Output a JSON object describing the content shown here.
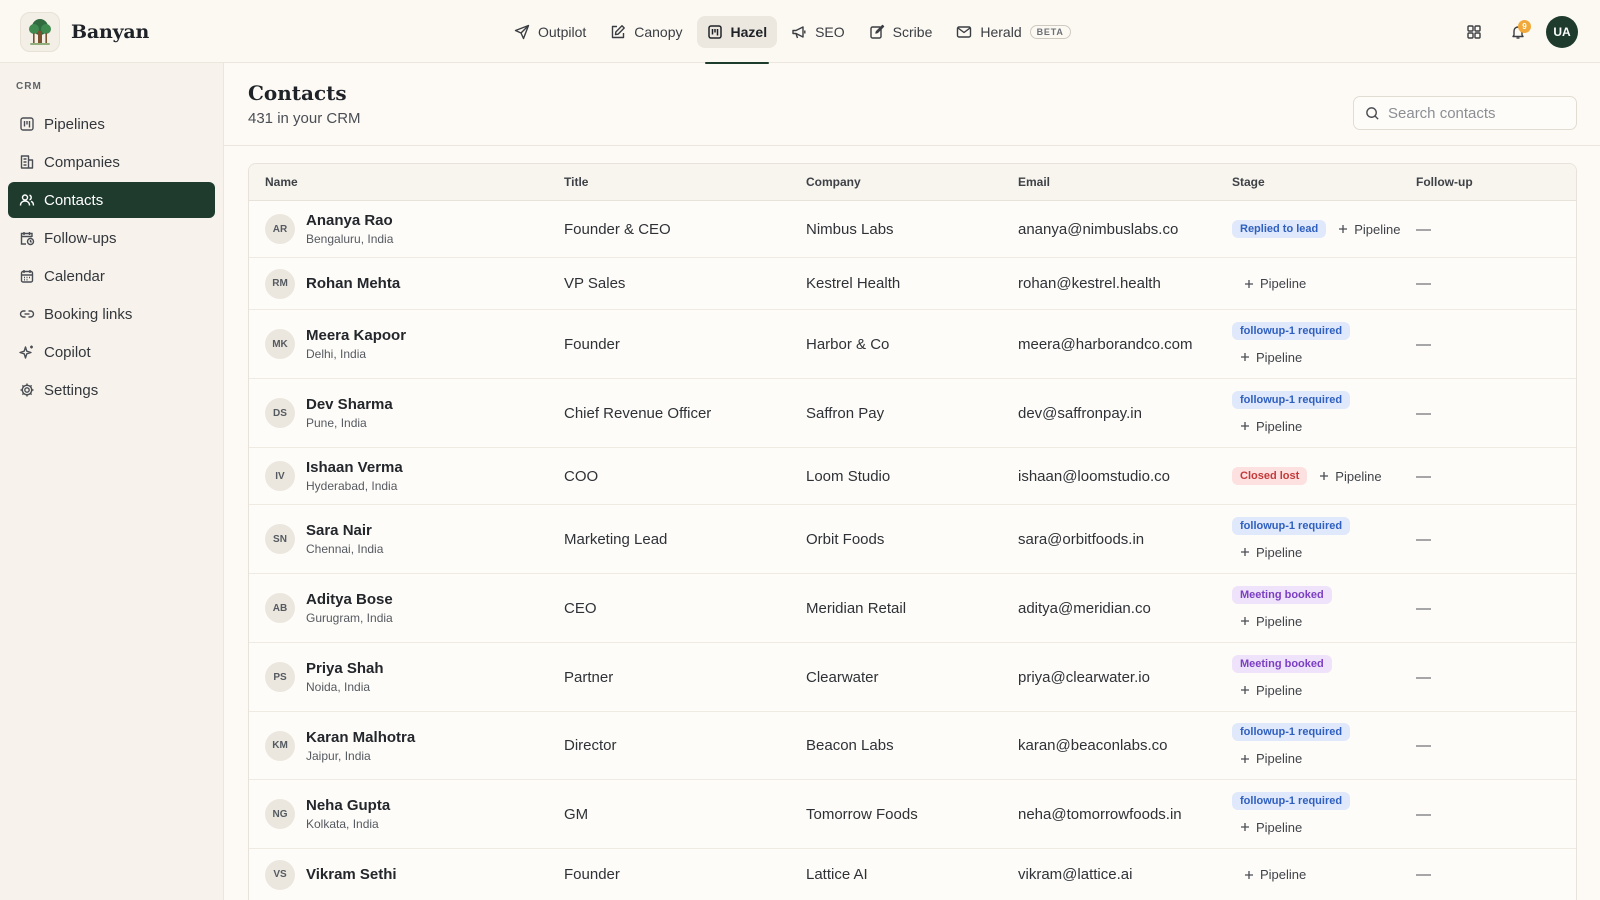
{
  "app": {
    "name": "Banyan"
  },
  "topnav": [
    {
      "label": "Outpilot",
      "icon": "send-icon"
    },
    {
      "label": "Canopy",
      "icon": "edit-icon"
    },
    {
      "label": "Hazel",
      "icon": "kanban-icon",
      "active": true
    },
    {
      "label": "SEO",
      "icon": "megaphone-icon"
    },
    {
      "label": "Scribe",
      "icon": "compose-icon"
    },
    {
      "label": "Herald",
      "icon": "mail-icon",
      "badge": "BETA"
    }
  ],
  "header_right": {
    "notification_count": "9",
    "user_initials": "UA"
  },
  "sidebar": {
    "section": "CRM",
    "items": [
      {
        "label": "Pipelines",
        "icon": "pipeline-icon"
      },
      {
        "label": "Companies",
        "icon": "building-icon"
      },
      {
        "label": "Contacts",
        "icon": "users-icon",
        "active": true
      },
      {
        "label": "Follow-ups",
        "icon": "calendar-clock-icon"
      },
      {
        "label": "Calendar",
        "icon": "calendar-icon"
      },
      {
        "label": "Booking links",
        "icon": "link-icon"
      },
      {
        "label": "Copilot",
        "icon": "sparkle-icon"
      },
      {
        "label": "Settings",
        "icon": "gear-icon"
      }
    ]
  },
  "page": {
    "title": "Contacts",
    "subtitle": "431 in your CRM",
    "search_placeholder": "Search contacts"
  },
  "table": {
    "columns": [
      "Name",
      "Title",
      "Company",
      "Email",
      "Stage",
      "Follow-up"
    ],
    "pipeline_label": "Pipeline",
    "rows": [
      {
        "initials": "AR",
        "name": "Ananya Rao",
        "location": "Bengaluru, India",
        "title": "Founder & CEO",
        "company": "Nimbus Labs",
        "email": "ananya@nimbuslabs.co",
        "stage": "Replied to lead",
        "stage_color": "blue",
        "follow_up": "—"
      },
      {
        "initials": "RM",
        "name": "Rohan Mehta",
        "location": "",
        "title": "VP Sales",
        "company": "Kestrel Health",
        "email": "rohan@kestrel.health",
        "stage": "",
        "stage_color": "",
        "follow_up": "—"
      },
      {
        "initials": "MK",
        "name": "Meera Kapoor",
        "location": "Delhi, India",
        "title": "Founder",
        "company": "Harbor & Co",
        "email": "meera@harborandco.com",
        "stage": "followup-1 required",
        "stage_color": "blue",
        "follow_up": "—"
      },
      {
        "initials": "DS",
        "name": "Dev Sharma",
        "location": "Pune, India",
        "title": "Chief Revenue Officer",
        "company": "Saffron Pay",
        "email": "dev@saffronpay.in",
        "stage": "followup-1 required",
        "stage_color": "blue",
        "follow_up": "—"
      },
      {
        "initials": "IV",
        "name": "Ishaan Verma",
        "location": "Hyderabad, India",
        "title": "COO",
        "company": "Loom Studio",
        "email": "ishaan@loomstudio.co",
        "stage": "Closed lost",
        "stage_color": "red",
        "follow_up": "—"
      },
      {
        "initials": "SN",
        "name": "Sara Nair",
        "location": "Chennai, India",
        "title": "Marketing Lead",
        "company": "Orbit Foods",
        "email": "sara@orbitfoods.in",
        "stage": "followup-1 required",
        "stage_color": "blue",
        "follow_up": "—"
      },
      {
        "initials": "AB",
        "name": "Aditya Bose",
        "location": "Gurugram, India",
        "title": "CEO",
        "company": "Meridian Retail",
        "email": "aditya@meridian.co",
        "stage": "Meeting booked",
        "stage_color": "purple",
        "follow_up": "—"
      },
      {
        "initials": "PS",
        "name": "Priya Shah",
        "location": "Noida, India",
        "title": "Partner",
        "company": "Clearwater",
        "email": "priya@clearwater.io",
        "stage": "Meeting booked",
        "stage_color": "purple",
        "follow_up": "—"
      },
      {
        "initials": "KM",
        "name": "Karan Malhotra",
        "location": "Jaipur, India",
        "title": "Director",
        "company": "Beacon Labs",
        "email": "karan@beaconlabs.co",
        "stage": "followup-1 required",
        "stage_color": "blue",
        "follow_up": "—"
      },
      {
        "initials": "NG",
        "name": "Neha Gupta",
        "location": "Kolkata, India",
        "title": "GM",
        "company": "Tomorrow Foods",
        "email": "neha@tomorrowfoods.in",
        "stage": "followup-1 required",
        "stage_color": "blue",
        "follow_up": "—"
      },
      {
        "initials": "VS",
        "name": "Vikram Sethi",
        "location": "",
        "title": "Founder",
        "company": "Lattice AI",
        "email": "vikram@lattice.ai",
        "stage": "",
        "stage_color": "",
        "follow_up": "—"
      }
    ]
  }
}
